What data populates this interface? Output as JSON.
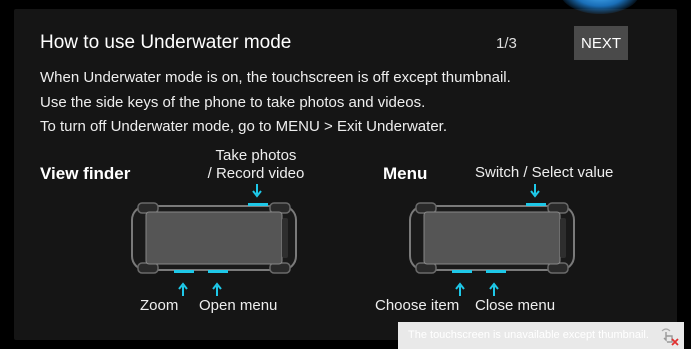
{
  "header": {
    "title": "How to use Underwater mode",
    "page_indicator": "1/3",
    "next_label": "NEXT"
  },
  "description": {
    "line1": "When Underwater mode is on, the touchscreen is off except thumbnail.",
    "line2": "Use the side keys of the phone to take photos and videos.",
    "line3": "To turn off Underwater mode, go to MENU > Exit Underwater."
  },
  "viewfinder": {
    "title": "View finder",
    "top_key_label_line1": "Take photos",
    "top_key_label_line2": "/ Record video",
    "zoom_label": "Zoom",
    "open_menu_label": "Open menu"
  },
  "menu": {
    "title": "Menu",
    "top_key_label": "Switch / Select value",
    "choose_item_label": "Choose item",
    "close_menu_label": "Close menu"
  },
  "toast": {
    "message": "The touchscreen is unavailable except thumbnail."
  },
  "colors": {
    "accent": "#1ec8e8",
    "background": "#151515",
    "button": "#4a4a4a",
    "toast": "#e9e9e9"
  },
  "icons": {
    "arrow": "down-arrow-icon / up-arrow-icon",
    "toast": "touch-disabled-icon"
  }
}
